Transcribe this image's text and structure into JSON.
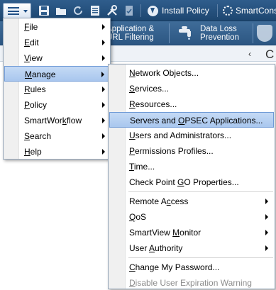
{
  "toolbar": {
    "install_policy_label": "Install Policy",
    "smartconsole_label": "SmartCons"
  },
  "blades": [
    {
      "line1": "Application &",
      "line2": "URL Filtering"
    },
    {
      "line1": "Data Loss",
      "line2": "Prevention"
    }
  ],
  "panel": {
    "collapse_glyph": "‹",
    "title_fragment": "C"
  },
  "main_menu": {
    "items": [
      {
        "pre": "",
        "u": "F",
        "post": "ile",
        "has_submenu": true
      },
      {
        "pre": "",
        "u": "E",
        "post": "dit",
        "has_submenu": true
      },
      {
        "pre": "",
        "u": "V",
        "post": "iew",
        "has_submenu": true
      },
      {
        "pre": "",
        "u": "M",
        "post": "anage",
        "has_submenu": true,
        "active": true
      },
      {
        "pre": "",
        "u": "R",
        "post": "ules",
        "has_submenu": true
      },
      {
        "pre": "",
        "u": "P",
        "post": "olicy",
        "has_submenu": true
      },
      {
        "pre": "SmartWor",
        "u": "k",
        "post": "flow",
        "has_submenu": true
      },
      {
        "pre": "",
        "u": "S",
        "post": "earch",
        "has_submenu": true
      },
      {
        "pre": "",
        "u": "H",
        "post": "elp",
        "has_submenu": true
      }
    ]
  },
  "manage_menu": {
    "items": [
      {
        "pre": "",
        "u": "N",
        "post": "etwork Objects..."
      },
      {
        "pre": "",
        "u": "S",
        "post": "ervices..."
      },
      {
        "pre": "",
        "u": "R",
        "post": "esources..."
      },
      {
        "pre": "Servers and ",
        "u": "O",
        "post": "PSEC Applications...",
        "active": true
      },
      {
        "pre": "",
        "u": "U",
        "post": "sers and Administrators..."
      },
      {
        "pre": "",
        "u": "P",
        "post": "ermissions Profiles..."
      },
      {
        "pre": "",
        "u": "T",
        "post": "ime..."
      },
      {
        "pre": "Check Point ",
        "u": "G",
        "post": "O Properties..."
      },
      {
        "separator": true
      },
      {
        "pre": "Remote A",
        "u": "c",
        "post": "cess",
        "has_submenu": true
      },
      {
        "pre": "",
        "u": "Q",
        "post": "oS",
        "has_submenu": true
      },
      {
        "pre": "SmartView ",
        "u": "M",
        "post": "onitor",
        "has_submenu": true
      },
      {
        "pre": "User ",
        "u": "A",
        "post": "uthority",
        "has_submenu": true
      },
      {
        "separator": true
      },
      {
        "pre": "",
        "u": "C",
        "post": "hange My Password..."
      },
      {
        "pre": "",
        "u": "D",
        "post": "isable User Expiration Warning",
        "disabled": true
      }
    ]
  },
  "colors": {
    "toolbar_bg": "#1d4670",
    "highlight": "#a9c7ee",
    "disabled_text": "#8d8d8d"
  }
}
